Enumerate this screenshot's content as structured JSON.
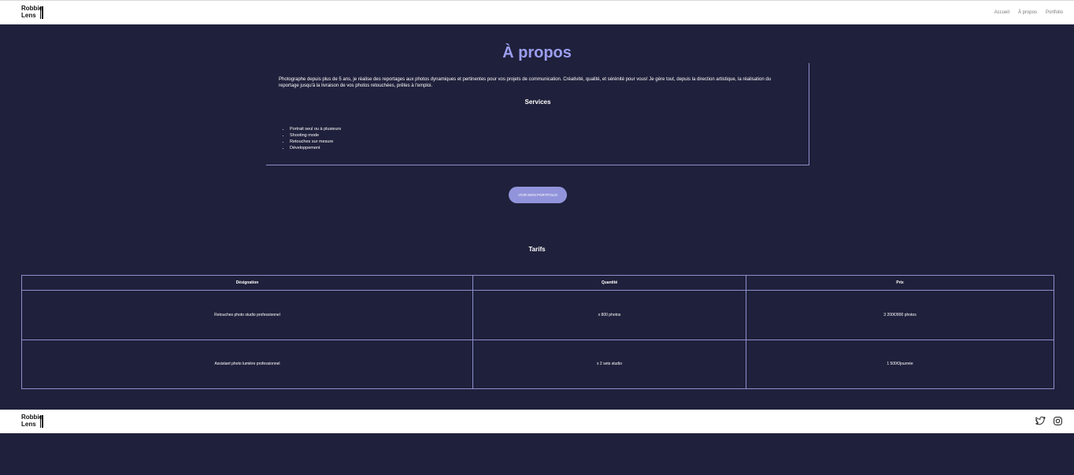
{
  "header": {
    "logo_line1": "Robbie",
    "logo_line2": "Lens",
    "nav": [
      "Accueil",
      "À propos",
      "Portfolio"
    ]
  },
  "about": {
    "title": "À propos",
    "text": "Photographe depuis plus de 5 ans, je réalise des reportages aux photos dynamiques et pertinentes pour vos projets de communication. Créativité, qualité, et sérénité pour vous! Je gère tout, depuis la direction artistique, la réalisation du reportage jusqu'à la livraison de vos photos retouchées, prêtes à l'emploi.",
    "services_title": "Services",
    "services": [
      "Portrait seul ou à plusieurs",
      "Shooting mode",
      "Retouches sur mesure",
      "Développement"
    ],
    "cta": "VOIR MON PORTFOLIO"
  },
  "tarifs": {
    "title": "Tarifs",
    "headers": [
      "Désignation",
      "Quantité",
      "Prix"
    ],
    "rows": [
      [
        "Retouches photo studio professionnel",
        "x 800 photos",
        "3 200€/800 photos"
      ],
      [
        "Assistant photo lumière professionnel",
        "x 2 sets studio",
        "1 500€/journée"
      ]
    ]
  },
  "footer": {
    "logo_line1": "Robbie",
    "logo_line2": "Lens",
    "social_icons": [
      "twitter-icon",
      "instagram-icon"
    ]
  },
  "colors": {
    "background": "#1f203b",
    "accent": "#9c9ef0",
    "button": "#9294db",
    "border": "#8d8fcb"
  }
}
